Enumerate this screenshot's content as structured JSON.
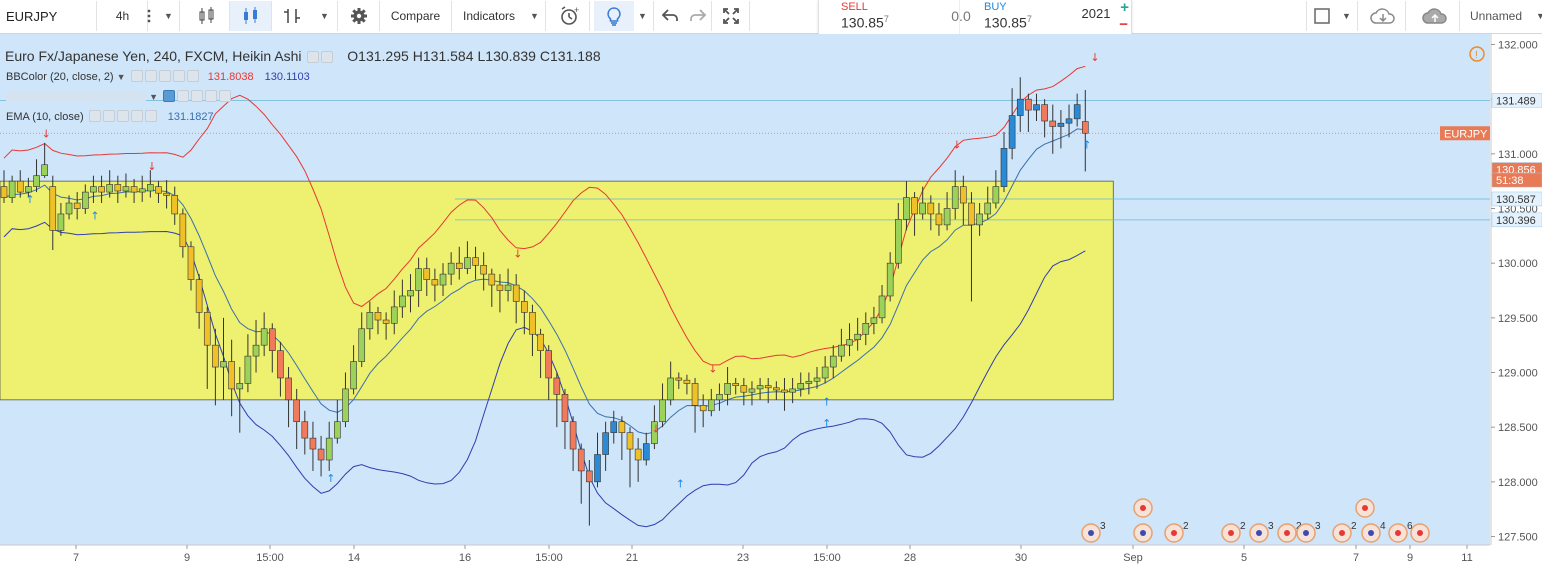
{
  "toolbar": {
    "symbol": "EURJPY",
    "interval": "4h",
    "compare_label": "Compare",
    "indicators_label": "Indicators",
    "layout_name": "Unnamed"
  },
  "trade": {
    "sell_label": "SELL",
    "sell_price": "130.85",
    "sell_pip": "7",
    "spread": "0.0",
    "buy_label": "BUY",
    "buy_price": "130.85",
    "buy_pip": "7",
    "quantity": "2021"
  },
  "legend": {
    "title": "Euro Fx/Japanese Yen, 240, FXCM, Heikin Ashi",
    "open": "O131.295",
    "high": "H131.584",
    "low": "L130.839",
    "close": "C131.188"
  },
  "indicators": {
    "bb_label": "BBColor (20, close, 2)",
    "bb_upper": "131.8038",
    "bb_lower": "130.1103",
    "ema_label": "EMA (10, close)",
    "ema_value": "131.1827"
  },
  "price_axis": {
    "ticks": [
      "132.000",
      "131.500",
      "131.000",
      "130.500",
      "130.000",
      "129.500",
      "129.000",
      "128.500",
      "128.000",
      "127.500"
    ],
    "labels": [
      {
        "text": "131.489",
        "bg": "#e3f2fd",
        "fg": "#333333"
      },
      {
        "text": "EURJPY",
        "bg": "#e87a56",
        "fg": "#ffffff"
      },
      {
        "text": "130.856",
        "bg": "#e87a56",
        "fg": "#ffffff"
      },
      {
        "text": "51:38",
        "bg": "#e87a56",
        "fg": "#ffffff"
      },
      {
        "text": "130.587",
        "bg": "#e3f2fd",
        "fg": "#333333"
      },
      {
        "text": "130.396",
        "bg": "#e3f2fd",
        "fg": "#333333"
      }
    ]
  },
  "time_axis": {
    "ticks": [
      "7",
      "9",
      "15:00",
      "14",
      "16",
      "15:00",
      "21",
      "23",
      "15:00",
      "28",
      "30",
      "Sep",
      "5",
      "7",
      "9",
      "11"
    ]
  },
  "events": [
    {
      "count": "3",
      "kind": "calendar"
    },
    {
      "count": "2",
      "kind": "mixed"
    },
    {
      "count": "2",
      "kind": "mixed"
    },
    {
      "count": "3",
      "kind": "calendar"
    },
    {
      "count": "2",
      "kind": "mixed"
    },
    {
      "count": "3",
      "kind": "calendar"
    },
    {
      "count": "2",
      "kind": "mixed"
    },
    {
      "count": "4",
      "kind": "calendar"
    },
    {
      "count": "6",
      "kind": "mixed"
    }
  ],
  "colors": {
    "background": "#cfe5f9",
    "zone": "#eef06f",
    "bull": "#9dd25a",
    "bear": "#f0c028",
    "bull_strong": "#2a8ad6",
    "bear_strong": "#f07a5c",
    "bb_upper": "#e53935",
    "bb_lower": "#2e3fb0",
    "ema": "#3a6fb0"
  },
  "chart_data": {
    "type": "candlestick",
    "title": "Euro Fx/Japanese Yen, 240, FXCM, Heikin Ashi",
    "ylim": [
      127.45,
      132.05
    ],
    "zone": {
      "low": 128.75,
      "high": 130.75
    },
    "hlines": [
      131.489,
      130.587,
      130.396
    ],
    "candles": [
      [
        130.7,
        130.6,
        130.85,
        130.55
      ],
      [
        130.6,
        130.75,
        130.8,
        130.55
      ],
      [
        130.75,
        130.65,
        130.85,
        130.6
      ],
      [
        130.65,
        130.7,
        130.78,
        130.6
      ],
      [
        130.7,
        130.8,
        130.95,
        130.65
      ],
      [
        130.8,
        130.9,
        131.1,
        130.78
      ],
      [
        130.7,
        130.3,
        130.8,
        130.12
      ],
      [
        130.3,
        130.45,
        130.55,
        130.25
      ],
      [
        130.45,
        130.55,
        130.62,
        130.4
      ],
      [
        130.55,
        130.5,
        130.65,
        130.4
      ],
      [
        130.5,
        130.65,
        130.72,
        130.45
      ],
      [
        130.65,
        130.7,
        130.8,
        130.55
      ],
      [
        130.7,
        130.65,
        130.8,
        130.55
      ],
      [
        130.65,
        130.72,
        130.85,
        130.6
      ],
      [
        130.72,
        130.66,
        130.8,
        130.55
      ],
      [
        130.66,
        130.7,
        130.82,
        130.6
      ],
      [
        130.7,
        130.65,
        130.77,
        130.55
      ],
      [
        130.65,
        130.68,
        130.8,
        130.56
      ],
      [
        130.66,
        130.72,
        130.85,
        130.6
      ],
      [
        130.7,
        130.64,
        130.75,
        130.55
      ],
      [
        130.64,
        130.62,
        130.76,
        130.5
      ],
      [
        130.62,
        130.45,
        130.7,
        130.35
      ],
      [
        130.45,
        130.15,
        130.5,
        130.05
      ],
      [
        130.15,
        129.85,
        130.2,
        129.75
      ],
      [
        129.85,
        129.55,
        129.9,
        129.4
      ],
      [
        129.55,
        129.25,
        129.6,
        128.85
      ],
      [
        129.25,
        129.05,
        129.4,
        128.7
      ],
      [
        129.05,
        129.1,
        129.5,
        128.75
      ],
      [
        129.1,
        128.85,
        129.3,
        128.6
      ],
      [
        128.85,
        128.9,
        129.05,
        128.45
      ],
      [
        128.9,
        129.15,
        129.35,
        128.82
      ],
      [
        129.15,
        129.25,
        129.48,
        129.0
      ],
      [
        129.25,
        129.4,
        129.55,
        129.15
      ],
      [
        129.4,
        129.2,
        129.45,
        129.0
      ],
      [
        129.2,
        128.95,
        129.28,
        128.78
      ],
      [
        128.95,
        128.75,
        129.05,
        128.5
      ],
      [
        128.75,
        128.55,
        128.85,
        128.3
      ],
      [
        128.55,
        128.4,
        128.65,
        128.25
      ],
      [
        128.4,
        128.3,
        128.55,
        128.1
      ],
      [
        128.3,
        128.2,
        128.42,
        128.05
      ],
      [
        128.2,
        128.4,
        128.55,
        128.1
      ],
      [
        128.4,
        128.55,
        128.75,
        128.35
      ],
      [
        128.55,
        128.85,
        129.0,
        128.5
      ],
      [
        128.85,
        129.1,
        129.25,
        128.8
      ],
      [
        129.1,
        129.4,
        129.55,
        129.05
      ],
      [
        129.4,
        129.55,
        129.65,
        129.3
      ],
      [
        129.55,
        129.48,
        129.6,
        129.35
      ],
      [
        129.48,
        129.45,
        129.55,
        129.3
      ],
      [
        129.45,
        129.6,
        129.75,
        129.35
      ],
      [
        129.6,
        129.7,
        129.85,
        129.5
      ],
      [
        129.7,
        129.75,
        129.9,
        129.55
      ],
      [
        129.75,
        129.95,
        130.05,
        129.6
      ],
      [
        129.95,
        129.85,
        130.05,
        129.7
      ],
      [
        129.85,
        129.8,
        129.95,
        129.65
      ],
      [
        129.8,
        129.9,
        130.0,
        129.7
      ],
      [
        129.9,
        130.0,
        130.1,
        129.8
      ],
      [
        130.0,
        129.95,
        130.15,
        129.85
      ],
      [
        129.95,
        130.05,
        130.2,
        129.9
      ],
      [
        130.05,
        129.98,
        130.15,
        129.85
      ],
      [
        129.98,
        129.9,
        130.1,
        129.75
      ],
      [
        129.9,
        129.8,
        129.95,
        129.6
      ],
      [
        129.8,
        129.75,
        129.9,
        129.55
      ],
      [
        129.75,
        129.8,
        129.95,
        129.65
      ],
      [
        129.8,
        129.65,
        129.9,
        129.45
      ],
      [
        129.65,
        129.55,
        129.75,
        129.35
      ],
      [
        129.55,
        129.35,
        129.62,
        129.15
      ],
      [
        129.35,
        129.2,
        129.4,
        128.95
      ],
      [
        129.2,
        128.95,
        129.25,
        128.75
      ],
      [
        128.95,
        128.8,
        129.0,
        128.5
      ],
      [
        128.8,
        128.55,
        128.85,
        128.3
      ],
      [
        128.55,
        128.3,
        128.6,
        128.1
      ],
      [
        128.3,
        128.1,
        128.35,
        127.8
      ],
      [
        128.1,
        128.0,
        128.2,
        127.6
      ],
      [
        128.0,
        128.25,
        128.45,
        127.95
      ],
      [
        128.25,
        128.45,
        128.55,
        128.1
      ],
      [
        128.45,
        128.55,
        128.65,
        128.35
      ],
      [
        128.55,
        128.45,
        128.6,
        128.2
      ],
      [
        128.45,
        128.3,
        128.5,
        127.95
      ],
      [
        128.3,
        128.2,
        128.4,
        128.0
      ],
      [
        128.2,
        128.35,
        128.45,
        128.15
      ],
      [
        128.35,
        128.55,
        128.7,
        128.3
      ],
      [
        128.55,
        128.75,
        128.9,
        128.5
      ],
      [
        128.75,
        128.95,
        129.1,
        128.7
      ],
      [
        128.95,
        128.93,
        129.0,
        128.85
      ],
      [
        128.93,
        128.9,
        128.98,
        128.8
      ],
      [
        128.9,
        128.7,
        128.95,
        128.45
      ],
      [
        128.7,
        128.65,
        128.8,
        128.5
      ],
      [
        128.65,
        128.75,
        128.85,
        128.6
      ],
      [
        128.75,
        128.8,
        128.9,
        128.65
      ],
      [
        128.8,
        128.9,
        129.05,
        128.7
      ],
      [
        128.9,
        128.88,
        128.95,
        128.8
      ],
      [
        128.88,
        128.82,
        128.95,
        128.7
      ],
      [
        128.82,
        128.85,
        128.92,
        128.7
      ],
      [
        128.85,
        128.88,
        128.95,
        128.75
      ],
      [
        128.88,
        128.86,
        128.95,
        128.72
      ],
      [
        128.86,
        128.84,
        128.92,
        128.75
      ],
      [
        128.84,
        128.82,
        128.95,
        128.65
      ],
      [
        128.82,
        128.85,
        128.95,
        128.72
      ],
      [
        128.85,
        128.9,
        129.0,
        128.78
      ],
      [
        128.9,
        128.92,
        129.0,
        128.8
      ],
      [
        128.92,
        128.95,
        129.05,
        128.85
      ],
      [
        128.95,
        129.05,
        129.15,
        128.9
      ],
      [
        129.05,
        129.15,
        129.25,
        128.95
      ],
      [
        129.15,
        129.25,
        129.4,
        129.1
      ],
      [
        129.25,
        129.3,
        129.45,
        129.15
      ],
      [
        129.3,
        129.35,
        129.5,
        129.2
      ],
      [
        129.35,
        129.45,
        129.55,
        129.25
      ],
      [
        129.45,
        129.5,
        129.6,
        129.35
      ],
      [
        129.5,
        129.7,
        129.8,
        129.45
      ],
      [
        129.7,
        130.0,
        130.1,
        129.65
      ],
      [
        130.0,
        130.4,
        130.55,
        129.95
      ],
      [
        130.4,
        130.6,
        130.75,
        130.3
      ],
      [
        130.6,
        130.45,
        130.65,
        130.25
      ],
      [
        130.45,
        130.55,
        130.7,
        130.4
      ],
      [
        130.55,
        130.45,
        130.62,
        130.3
      ],
      [
        130.45,
        130.35,
        130.55,
        130.25
      ],
      [
        130.35,
        130.5,
        130.65,
        130.3
      ],
      [
        130.5,
        130.7,
        130.85,
        130.4
      ],
      [
        130.7,
        130.55,
        130.8,
        130.35
      ],
      [
        130.55,
        130.35,
        130.65,
        129.65
      ],
      [
        130.35,
        130.45,
        130.55,
        130.25
      ],
      [
        130.45,
        130.55,
        130.7,
        130.4
      ],
      [
        130.55,
        130.7,
        130.85,
        130.5
      ],
      [
        130.7,
        131.05,
        131.2,
        130.65
      ],
      [
        131.05,
        131.35,
        131.6,
        130.95
      ],
      [
        131.35,
        131.5,
        131.7,
        131.2
      ],
      [
        131.5,
        131.4,
        131.55,
        131.2
      ],
      [
        131.4,
        131.45,
        131.55,
        131.3
      ],
      [
        131.45,
        131.3,
        131.5,
        131.15
      ],
      [
        131.3,
        131.25,
        131.45,
        131.0
      ],
      [
        131.25,
        131.28,
        131.4,
        131.05
      ],
      [
        131.28,
        131.32,
        131.45,
        131.15
      ],
      [
        131.32,
        131.45,
        131.55,
        131.25
      ],
      [
        131.295,
        131.188,
        131.584,
        130.839
      ]
    ]
  }
}
